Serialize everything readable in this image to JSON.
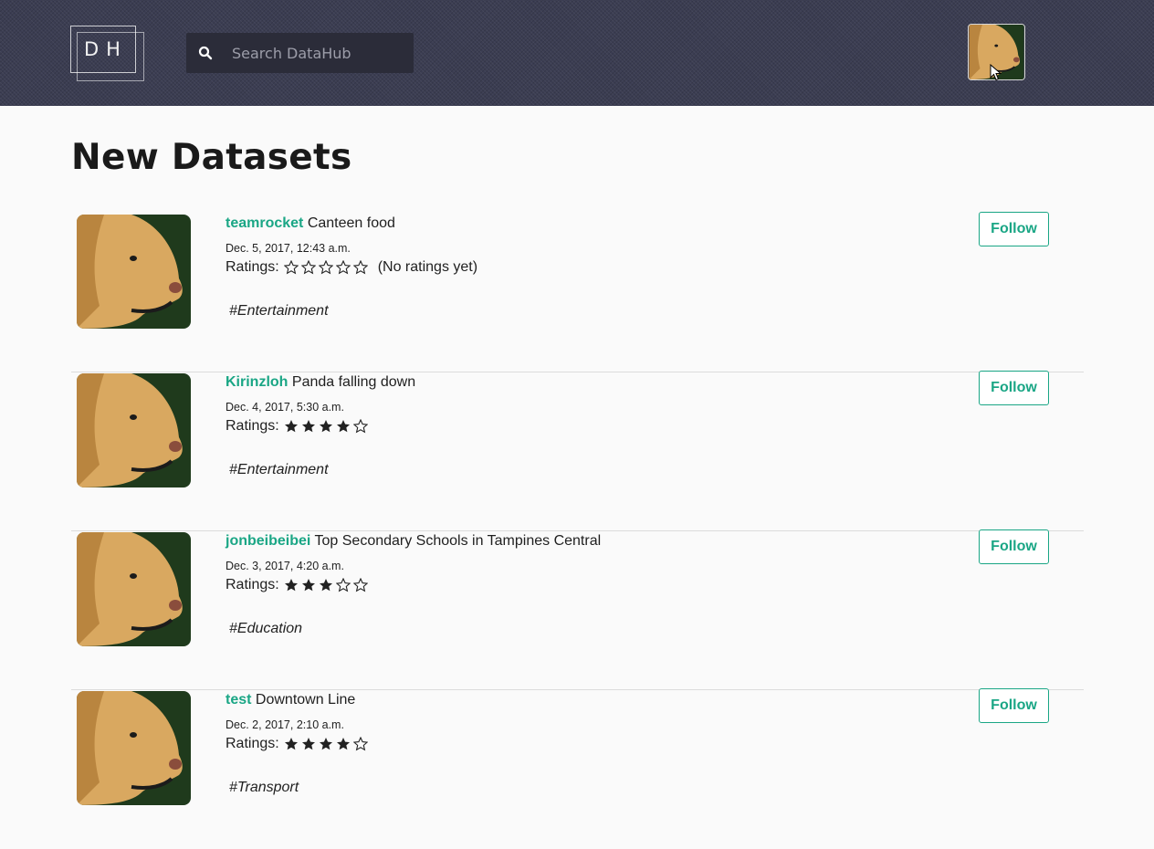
{
  "header": {
    "logo_text": "DH",
    "search_placeholder": "Search DataHub",
    "search_value": ""
  },
  "page_title": "New Datasets",
  "ratings_label": "Ratings:",
  "follow_label": "Follow",
  "colors": {
    "accent": "#1aa685",
    "header_bg": "#3b3d52"
  },
  "datasets": [
    {
      "user": "teamrocket",
      "name": "Canteen food",
      "date": "Dec. 5, 2017, 12:43 a.m.",
      "rating": 0,
      "rating_note": "(No ratings yet)",
      "tag": "#Entertainment"
    },
    {
      "user": "Kirinzloh",
      "name": "Panda falling down",
      "date": "Dec. 4, 2017, 5:30 a.m.",
      "rating": 4,
      "rating_note": "",
      "tag": "#Entertainment"
    },
    {
      "user": "jonbeibeibei",
      "name": "Top Secondary Schools in Tampines Central",
      "date": "Dec. 3, 2017, 4:20 a.m.",
      "rating": 3,
      "rating_note": "",
      "tag": "#Education"
    },
    {
      "user": "test",
      "name": "Downtown Line",
      "date": "Dec. 2, 2017, 2:10 a.m.",
      "rating": 4,
      "rating_note": "",
      "tag": "#Transport"
    }
  ]
}
